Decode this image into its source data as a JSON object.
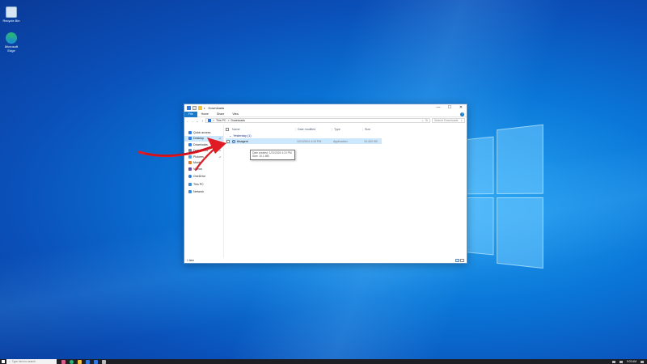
{
  "desktop": {
    "icons": [
      {
        "label": "Recycle Bin",
        "icon": "recycle-bin-icon",
        "color": "#d8e6f3"
      },
      {
        "label": "Microsoft Edge",
        "icon": "edge-icon",
        "color": "#2bb673"
      }
    ]
  },
  "window": {
    "title": "Downloads",
    "caption": {
      "minimize": "—",
      "maximize": "☐",
      "close": "✕"
    },
    "ribbon": {
      "tabs": [
        "File",
        "Home",
        "Share",
        "View"
      ],
      "help": "?"
    },
    "address": {
      "path": [
        "This PC",
        "Downloads"
      ],
      "separator": ">",
      "dropdown": "⌄",
      "refresh": "↻"
    },
    "search": {
      "placeholder": "Search Downloads",
      "icon": "search-icon"
    },
    "nav_buttons": {
      "back": "←",
      "forward": "→",
      "recent": "⌄",
      "up": "↑"
    },
    "sidebar": {
      "items": [
        {
          "label": "Quick access",
          "icon": "star-icon",
          "color": "#2d7be0",
          "pinned": false
        },
        {
          "label": "Desktop",
          "icon": "desktop-icon",
          "color": "#2d7be0",
          "pinned": true,
          "selected": true
        },
        {
          "label": "Downloads",
          "icon": "downloads-icon",
          "color": "#2d7be0",
          "pinned": true
        },
        {
          "label": "Documents",
          "icon": "documents-icon",
          "color": "#6b87a8",
          "pinned": true
        },
        {
          "label": "Pictures",
          "icon": "pictures-icon",
          "color": "#4aa0e0",
          "pinned": true
        },
        {
          "label": "Music",
          "icon": "music-icon",
          "color": "#e07a2d",
          "pinned": false
        },
        {
          "label": "Videos",
          "icon": "videos-icon",
          "color": "#6b4fa8",
          "pinned": false
        },
        {
          "label": "OneDrive",
          "icon": "onedrive-icon",
          "color": "#2d7be0",
          "pinned": false
        },
        {
          "label": "This PC",
          "icon": "this-pc-icon",
          "color": "#3a8ee0",
          "pinned": false
        },
        {
          "label": "Network",
          "icon": "network-icon",
          "color": "#3a8ee0",
          "pinned": false
        }
      ],
      "pin_glyph": "⊿"
    },
    "columns": [
      "Name",
      "Date modified",
      "Type",
      "Size"
    ],
    "group": {
      "label": "Yesterday (1)",
      "chevron": "⌄"
    },
    "files": [
      {
        "name": "tbsagent",
        "date": "1/21/2024 4:10 PM",
        "type": "Application",
        "size": "10,402 KB"
      }
    ],
    "tooltip": {
      "line1": "Date created: 1/21/2024 4:10 PM",
      "line2": "Size: 10.1 MB"
    },
    "status": {
      "count": "1 item"
    }
  },
  "taskbar": {
    "search_placeholder": "Type here to search",
    "time": "9:03 AM",
    "apps": [
      {
        "icon": "task-view-icon",
        "color": "#e05a8a"
      },
      {
        "icon": "edge-icon",
        "color": "#2bb673"
      },
      {
        "icon": "file-explorer-icon",
        "color": "#f0c040"
      },
      {
        "icon": "mail-icon",
        "color": "#2d7be0"
      },
      {
        "icon": "store-icon",
        "color": "#2d7be0"
      },
      {
        "icon": "settings-icon",
        "color": "#bbbbbb"
      }
    ]
  },
  "colors": {
    "accent": "#1979ca",
    "selection": "#cce8ff",
    "annotation": "#e01b24"
  }
}
